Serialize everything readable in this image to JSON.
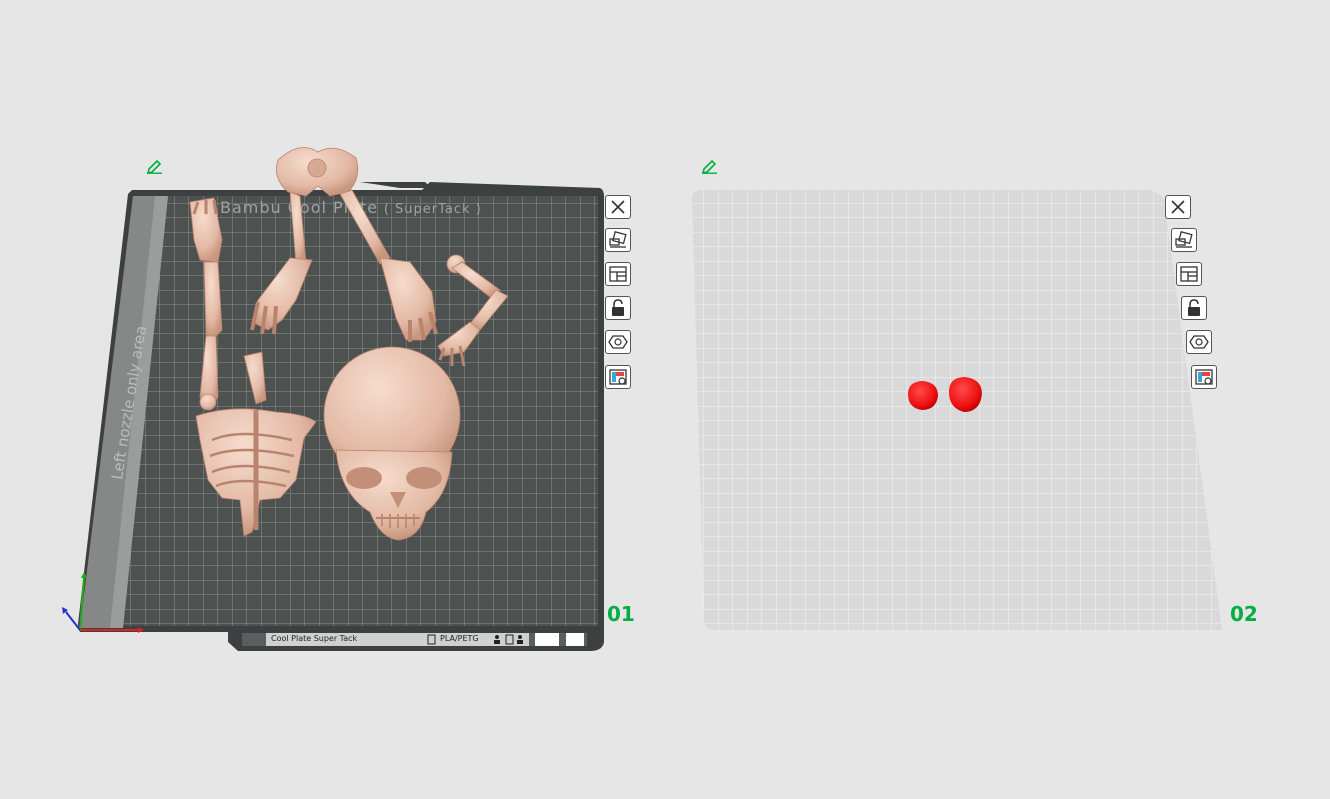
{
  "plates": [
    {
      "number": "01",
      "bed_title_brand": "Bambu Cool Plate",
      "bed_title_suffix": "( SuperTack )",
      "side_label": "Left nozzle only area",
      "info_plate": "Cool Plate Super Tack",
      "info_filament": "PLA/PETG",
      "objects": [
        "skull",
        "ribcage-spine",
        "pelvis-legs",
        "arm",
        "arm-hand",
        "leg-foot"
      ],
      "tools": [
        {
          "name": "close",
          "icon": "close-icon"
        },
        {
          "name": "arrange",
          "icon": "arrange-icon"
        },
        {
          "name": "layout",
          "icon": "layout-icon"
        },
        {
          "name": "lock",
          "icon": "lock-icon"
        },
        {
          "name": "auto-orient",
          "icon": "hexagon-orient-icon"
        },
        {
          "name": "plate-settings",
          "icon": "plate-settings-icon"
        }
      ]
    },
    {
      "number": "02",
      "objects": [
        "red-object-1",
        "red-object-2"
      ],
      "tools": [
        {
          "name": "close",
          "icon": "close-icon"
        },
        {
          "name": "arrange",
          "icon": "arrange-icon"
        },
        {
          "name": "layout",
          "icon": "layout-icon"
        },
        {
          "name": "lock",
          "icon": "lock-icon"
        },
        {
          "name": "auto-orient",
          "icon": "hexagon-orient-icon"
        },
        {
          "name": "plate-settings",
          "icon": "plate-settings-icon"
        }
      ]
    }
  ],
  "colors": {
    "background": "#e6e6e6",
    "bed_dark": "#4d5251",
    "bed_light": "#d9d9d9",
    "accent_green": "#00ae42",
    "bone": "#e8c3b0",
    "object_red": "#ee1111",
    "axis_x": "#dd2222",
    "axis_y": "#22aa22",
    "axis_z": "#2233cc"
  }
}
